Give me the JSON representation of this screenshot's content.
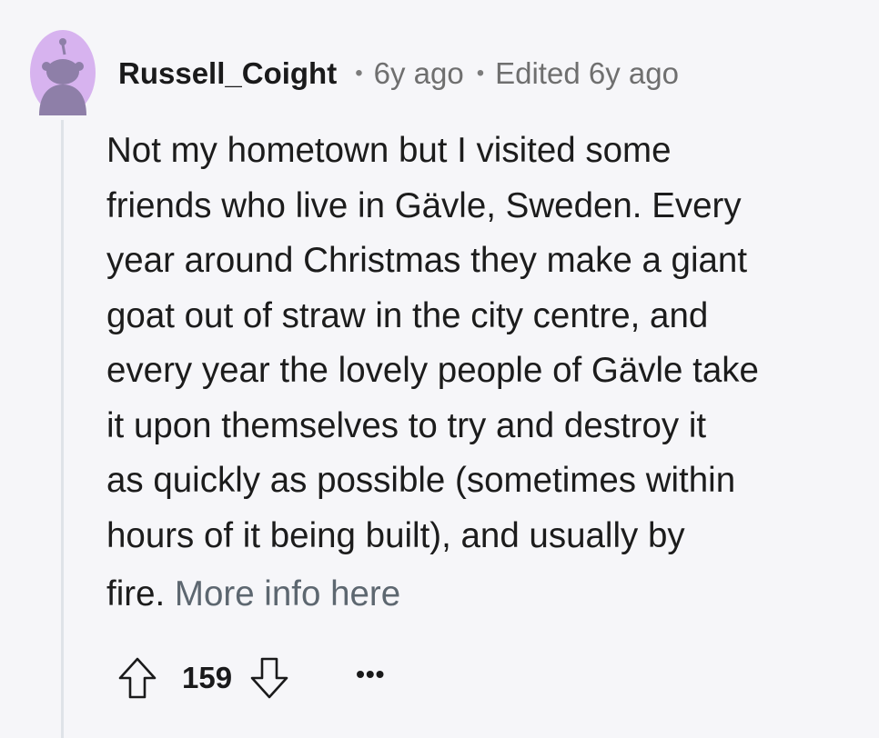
{
  "comment": {
    "username": "Russell_Coight",
    "separator": "•",
    "posted": "6y ago",
    "edited": "Edited 6y ago",
    "body_lines": [
      "Not my hometown but I visited some",
      "friends who live in Gävle, Sweden. Every",
      "year around Christmas they make a giant",
      "goat out of straw in the city centre, and",
      "every year the lovely people of Gävle take",
      "it upon themselves to try and destroy it",
      "as quickly as possible (sometimes within",
      "hours of it being built), and usually by"
    ],
    "last_line_text": "fire.",
    "link_text": "More info here",
    "score": "159",
    "more_options": "•••"
  },
  "colors": {
    "background": "#f6f6f9",
    "avatar_bg": "#d7b3ef",
    "avatar_figure": "#8e7fa8",
    "link": "#5d6770",
    "thread_line": "#dfe3e8"
  },
  "icons": {
    "avatar": "snoo-avatar-icon",
    "upvote": "upvote-arrow-icon",
    "downvote": "downvote-arrow-icon",
    "more": "more-options-icon"
  }
}
